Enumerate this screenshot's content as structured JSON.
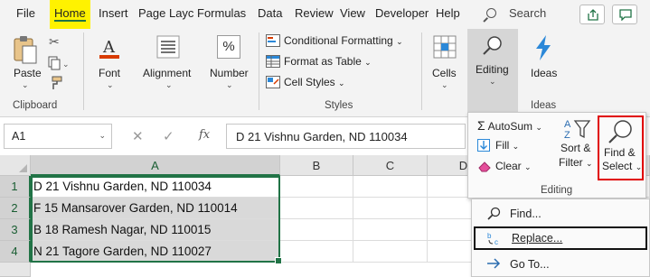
{
  "menu": {
    "tabs": [
      "File",
      "Home",
      "Insert",
      "Page Layc",
      "Formulas",
      "Data",
      "Review",
      "View",
      "Developer",
      "Help"
    ],
    "search": "Search"
  },
  "ribbon": {
    "clipboard": {
      "paste": "Paste",
      "label": "Clipboard"
    },
    "font": {
      "label": "Font"
    },
    "alignment": {
      "label": "Alignment"
    },
    "number": {
      "label": "Number",
      "symbol": "%"
    },
    "styles": {
      "conditional_formatting": "Conditional Formatting",
      "format_as_table": "Format as Table",
      "cell_styles": "Cell Styles",
      "label": "Styles"
    },
    "cells": {
      "label": "Cells"
    },
    "editing": {
      "label": "Editing"
    },
    "ideas": {
      "label": "Ideas",
      "group_label": "Ideas"
    }
  },
  "formula_bar": {
    "name_box": "A1",
    "fx": "fx",
    "formula": "D 21 Vishnu Garden, ND 110034"
  },
  "grid": {
    "columns": [
      "A",
      "B",
      "C",
      "D"
    ],
    "rows": [
      {
        "num": "1",
        "a": "D 21 Vishnu Garden, ND 110034",
        "highlight": false
      },
      {
        "num": "2",
        "a": "F 15 Mansarover Garden, ND 110014",
        "highlight": true
      },
      {
        "num": "3",
        "a": "B 18 Ramesh Nagar,  ND 110015",
        "highlight": true
      },
      {
        "num": "4",
        "a": "N 21 Tagore Garden, ND 110027",
        "highlight": true
      }
    ]
  },
  "editing_panel": {
    "autosum": "AutoSum",
    "fill": "Fill",
    "clear": "Clear",
    "sort_filter_1": "Sort &",
    "sort_filter_2": "Filter",
    "find_select_1": "Find &",
    "find_select_2": "Select",
    "label": "Editing"
  },
  "find_select_menu": {
    "find": "Find...",
    "replace": "Replace...",
    "goto": "Go To..."
  },
  "colors": {
    "accent": "#217346",
    "home_highlight": "#fff200",
    "find_select_outline": "#e00000",
    "font_icon_red": "#d83b01",
    "ideas_blue": "#2b88d8"
  }
}
